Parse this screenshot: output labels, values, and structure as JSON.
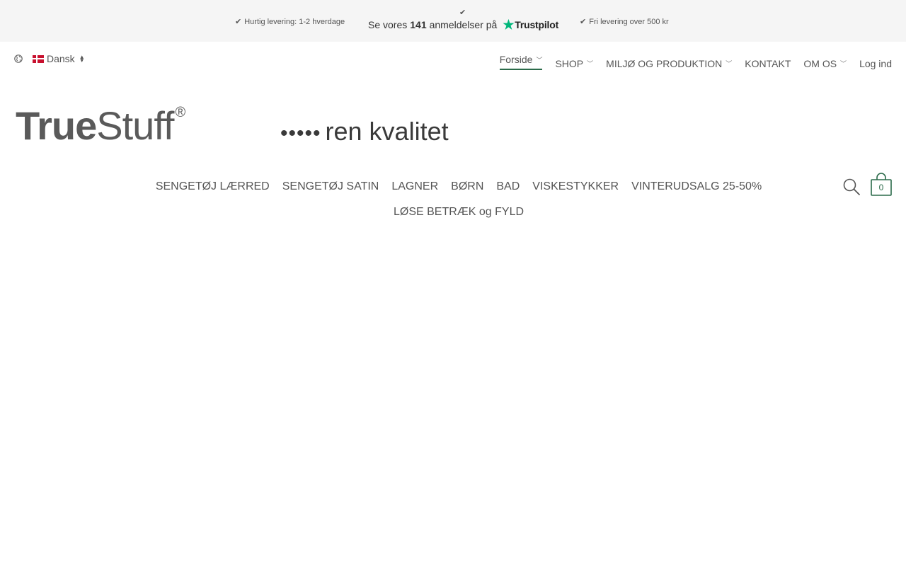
{
  "topbar": {
    "usp_left": "Hurtig levering: 1-2 hverdage",
    "usp_right": "Fri levering over 500 kr",
    "trustpilot": {
      "prefix": "Se vores",
      "count": "141",
      "suffix": "anmeldelser på",
      "brand": "Trustpilot",
      "star_color": "#00b67a"
    }
  },
  "language": {
    "selected": "Dansk",
    "icon": "globe-icon"
  },
  "topnav": {
    "items": [
      {
        "label": "Forside",
        "has_dropdown": true,
        "active": true
      },
      {
        "label": "SHOP",
        "has_dropdown": true
      },
      {
        "label": "MILJØ OG PRODUKTION",
        "has_dropdown": true
      },
      {
        "label": "KONTAKT",
        "has_dropdown": false
      },
      {
        "label": "OM OS",
        "has_dropdown": true
      },
      {
        "label": "Log ind",
        "has_dropdown": false
      }
    ],
    "accent": "#2b6b4a"
  },
  "logo": {
    "part1": "True",
    "part2": "Stuff",
    "reg": "®",
    "tagline_dots": "•••••",
    "tagline": "ren kvalitet"
  },
  "mainnav": {
    "items": [
      "SENGETØJ LÆRRED",
      "SENGETØJ SATIN",
      "LAGNER",
      "BØRN",
      "BAD",
      "VISKESTYKKER",
      "VINTERUDSALG 25-50%",
      "LØSE BETRÆK og FYLD"
    ]
  },
  "cart": {
    "count": "0",
    "accent": "#2b6b4a"
  }
}
